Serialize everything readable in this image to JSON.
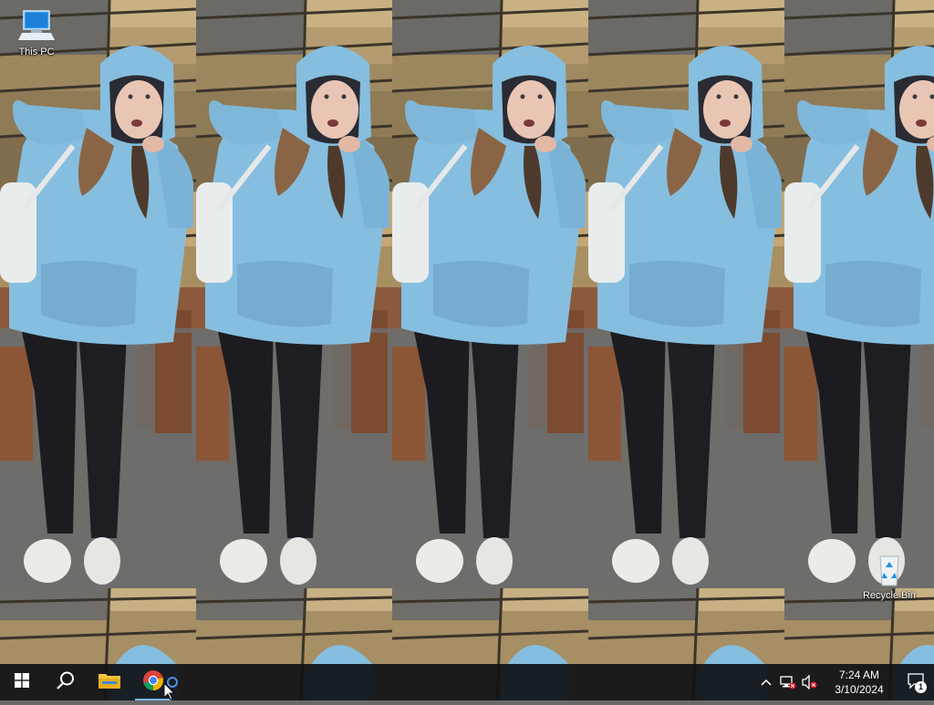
{
  "desktop": {
    "icons": [
      {
        "label": "This PC",
        "icon": "this-pc-icon"
      },
      {
        "label": "Recycle Bin",
        "icon": "recycle-bin-icon"
      }
    ],
    "wallpaper": {
      "subject": "tiled-photo",
      "tile_count": 5
    }
  },
  "taskbar": {
    "start": {
      "icon": "windows-logo-icon"
    },
    "search": {
      "icon": "search-icon"
    },
    "pinned": [
      {
        "app": "File Explorer",
        "icon": "folder-icon"
      },
      {
        "app": "Google Chrome",
        "icon": "chrome-icon",
        "active": true
      }
    ],
    "tray": {
      "chevron": "chevron-up-icon",
      "network": "network-icon",
      "volume": "volume-muted-icon",
      "time": "7:24 AM",
      "date": "3/10/2024",
      "notifications": {
        "icon": "action-center-icon",
        "count": "1"
      }
    }
  },
  "colors": {
    "taskbar": "#101216",
    "accent": "#76b9ed",
    "hoodie": "#86bedf"
  }
}
